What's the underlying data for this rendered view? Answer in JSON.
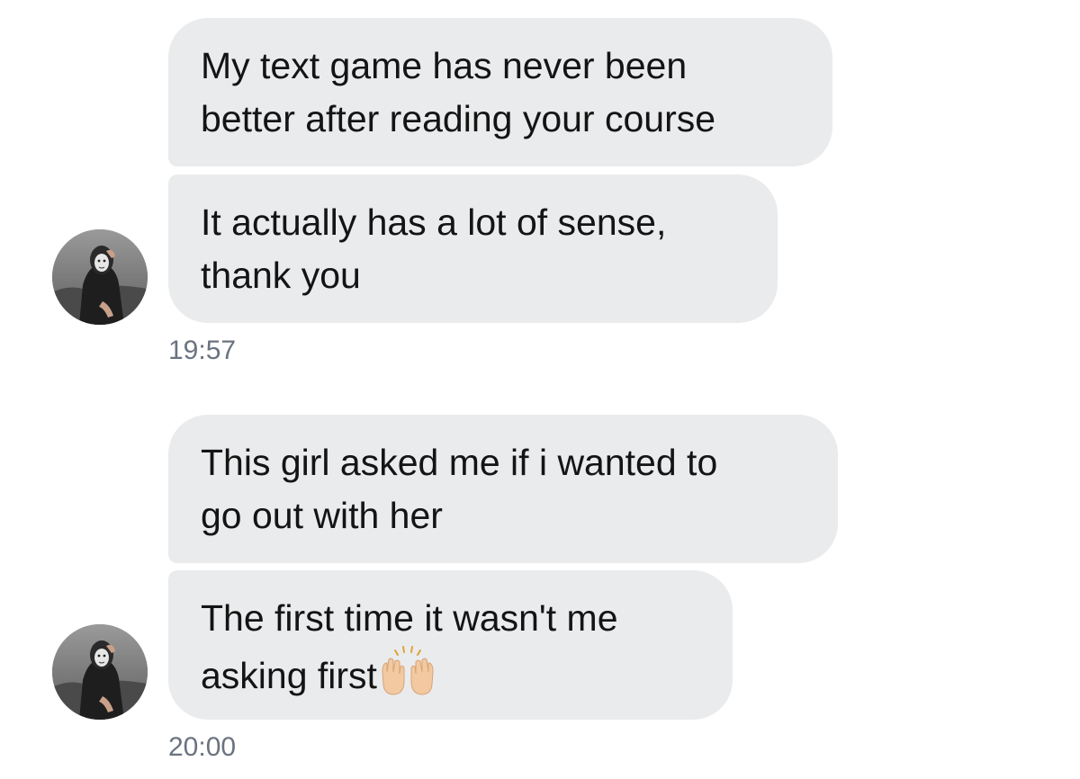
{
  "conversation": {
    "groups": [
      {
        "messages": [
          {
            "lines": [
              "My text game has never been",
              "better after reading your course"
            ]
          },
          {
            "lines": [
              "It actually has a lot of sense,",
              "thank you"
            ]
          }
        ],
        "timestamp": "19:57"
      },
      {
        "messages": [
          {
            "lines": [
              "This girl asked me if i wanted to",
              "go out with her"
            ]
          },
          {
            "lines": [
              "The first time it wasn't me",
              "asking first"
            ],
            "emoji": "raising-hands-emoji"
          }
        ],
        "timestamp": "20:00"
      }
    ]
  },
  "colors": {
    "bubble_background": "#eaebed",
    "text": "#141414",
    "timestamp": "#6b7380"
  }
}
